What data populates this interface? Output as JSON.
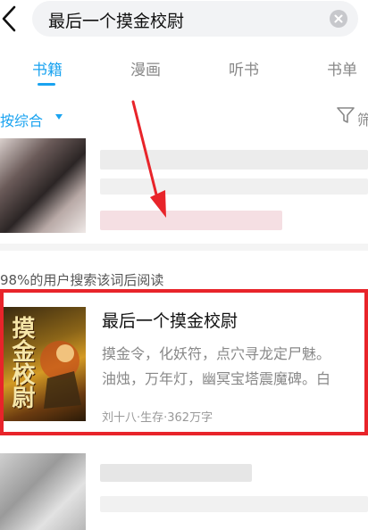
{
  "search": {
    "query": "最后一个摸金校尉",
    "back_icon": "chevron-left-icon",
    "clear_icon": "close-circle-icon"
  },
  "tabs": [
    {
      "label": "书籍",
      "active": true
    },
    {
      "label": "漫画",
      "active": false
    },
    {
      "label": "听书",
      "active": false
    },
    {
      "label": "书单",
      "active": false
    }
  ],
  "sort": {
    "label": "按综合",
    "filter_label": "筛"
  },
  "hint": "98%的用户搜索该词后阅读",
  "book": {
    "title": "最后一个摸金校尉",
    "desc_line1": "摸金令，化妖符，点穴寻龙定尸魅。",
    "desc_line2": "油烛，万年灯，幽冥宝塔震魔碑。白",
    "meta": "刘十八·生存·362万字",
    "cover_text": "摸金校尉"
  },
  "colors": {
    "accent": "#1aa3f0",
    "highlight_frame": "#e8242a"
  }
}
